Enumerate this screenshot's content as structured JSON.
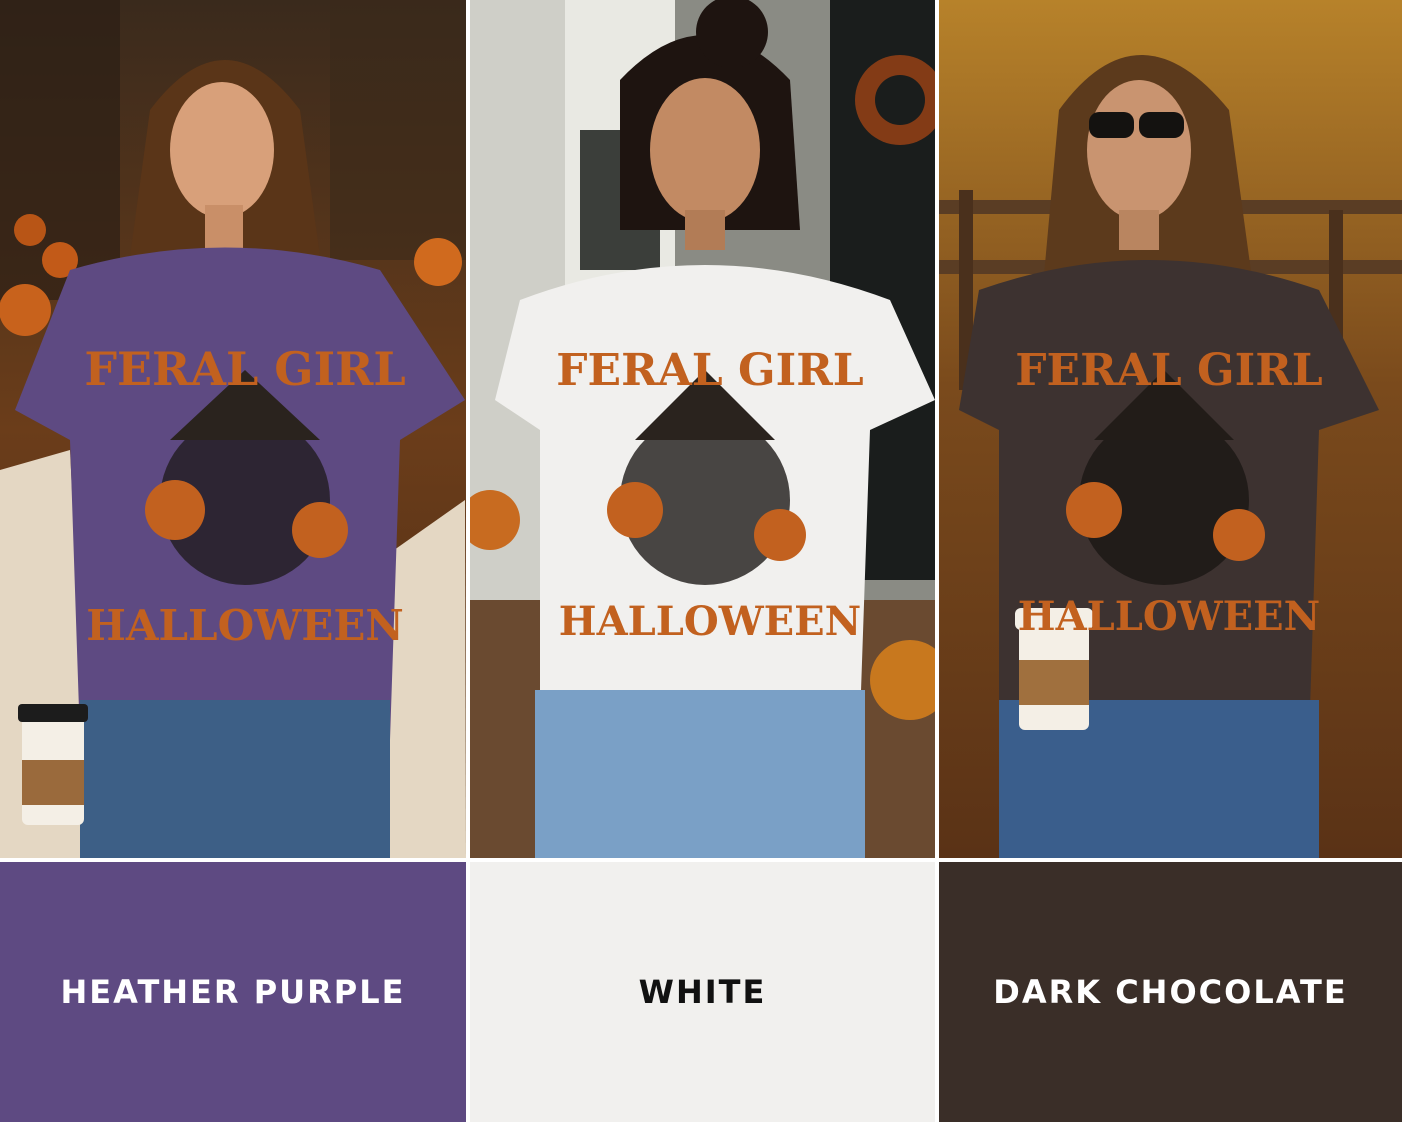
{
  "shirt_graphic": {
    "line1": "FERAL GIRL",
    "line2": "HALLOWEEN"
  },
  "swatches": [
    {
      "label": "HEATHER PURPLE",
      "color": "#5e4a82",
      "text_color": "#ffffff"
    },
    {
      "label": "WHITE",
      "color": "#f1f0ee",
      "text_color": "#111111"
    },
    {
      "label": "DARK CHOCOLATE",
      "color": "#3a2e28",
      "text_color": "#ffffff"
    }
  ],
  "colors": {
    "graphic_orange": "#c2611f",
    "jeans_blue": "#3d5f86"
  }
}
